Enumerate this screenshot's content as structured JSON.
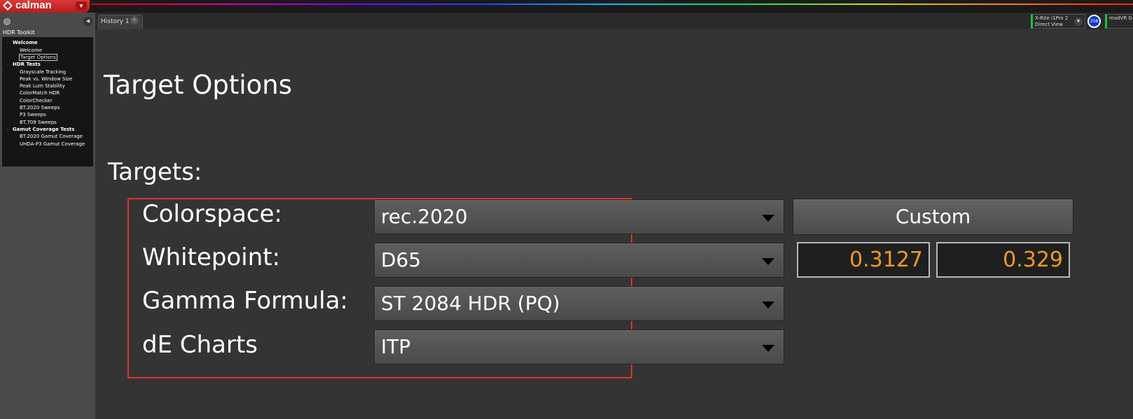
{
  "app": {
    "logo_text": "calman",
    "logo_menu_icon": "dropdown-arrow-icon"
  },
  "tabs": [
    {
      "label": "History 1"
    }
  ],
  "tab_add_label": "+",
  "meters": [
    {
      "line1": "X-Rite i1Pro 2",
      "line2": "Direct View",
      "badge": "258"
    },
    {
      "line1": "madVR G"
    }
  ],
  "sidebar": {
    "title": "HDR Toolkit",
    "tree": [
      {
        "group": "Welcome",
        "items": [
          {
            "label": "Welcome"
          },
          {
            "label": "Target Options",
            "selected": true
          }
        ]
      },
      {
        "group": "HDR Tests",
        "items": [
          {
            "label": "Grayscale Tracking"
          },
          {
            "label": "Peak vs. Window Size"
          },
          {
            "label": "Peak Lum Stability"
          },
          {
            "label": "ColorMatch HDR"
          },
          {
            "label": "ColorChecker"
          },
          {
            "label": "BT.2020 Sweeps"
          },
          {
            "label": "P3 Sweeps"
          },
          {
            "label": "BT.709 Sweeps"
          }
        ]
      },
      {
        "group": "Gamut Coverage Tests",
        "items": [
          {
            "label": "BT.2020 Gamut Coverage"
          },
          {
            "label": "UHDA-P3 Gamut Coverage"
          }
        ]
      }
    ]
  },
  "main": {
    "title": "Target Options",
    "targets_heading": "Targets:",
    "rows": [
      {
        "label": "Colorspace:",
        "value": "rec.2020"
      },
      {
        "label": "Whitepoint:",
        "value": "D65"
      },
      {
        "label": "Gamma Formula:",
        "value": "ST 2084 HDR (PQ)"
      },
      {
        "label": "dE Charts",
        "value": "ITP"
      }
    ],
    "custom_button": "Custom",
    "whitepoint_x": "0.3127",
    "whitepoint_y": "0.329"
  },
  "colors": {
    "accent_red": "#e0312d",
    "value_orange": "#f19a1f",
    "meter_green": "#19c43a",
    "badge_blue": "#1138c8"
  }
}
